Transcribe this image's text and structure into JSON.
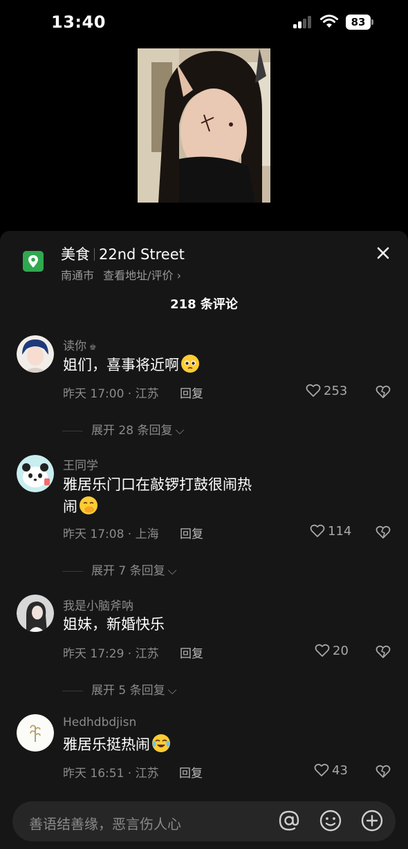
{
  "status": {
    "time": "13:40",
    "battery": "83"
  },
  "poi": {
    "category": "美食",
    "name": "22nd Street",
    "city": "南通市",
    "link": "查看地址/评价 ›"
  },
  "comments_count": "218 条评论",
  "comments": [
    {
      "user": "读你",
      "text": "姐们，喜事将近啊",
      "time": "昨天 17:00 · 江苏",
      "reply": "回复",
      "likes": "253",
      "expand": "展开 28 条回复"
    },
    {
      "user": "王同学",
      "text": "雅居乐门口在敲锣打鼓很闹热闹",
      "time": "昨天 17:08 · 上海",
      "reply": "回复",
      "likes": "114",
      "expand": "展开 7 条回复"
    },
    {
      "user": "我是小脑斧呐",
      "text": "姐妹，新婚快乐",
      "time": "昨天 17:29 · 江苏",
      "reply": "回复",
      "likes": "20",
      "expand": "展开 5 条回复"
    },
    {
      "user": "Hedhdbdjisn",
      "text": "雅居乐挺热闹",
      "time": "昨天 16:51 · 江苏",
      "reply": "回复",
      "likes": "43"
    }
  ],
  "input": {
    "placeholder": "善语结善缘，恶言伤人心"
  },
  "icons": {
    "location": "map-pin-icon",
    "close": "close-icon",
    "like": "heart-icon",
    "dislike": "broken-heart-icon",
    "mention": "at-icon",
    "emoji": "smiley-icon",
    "add": "plus-circle-icon"
  },
  "colors": {
    "sheet_bg": "#161616",
    "poi_icon": "#2fa84f",
    "secondary_text": "#8b8b8b"
  }
}
